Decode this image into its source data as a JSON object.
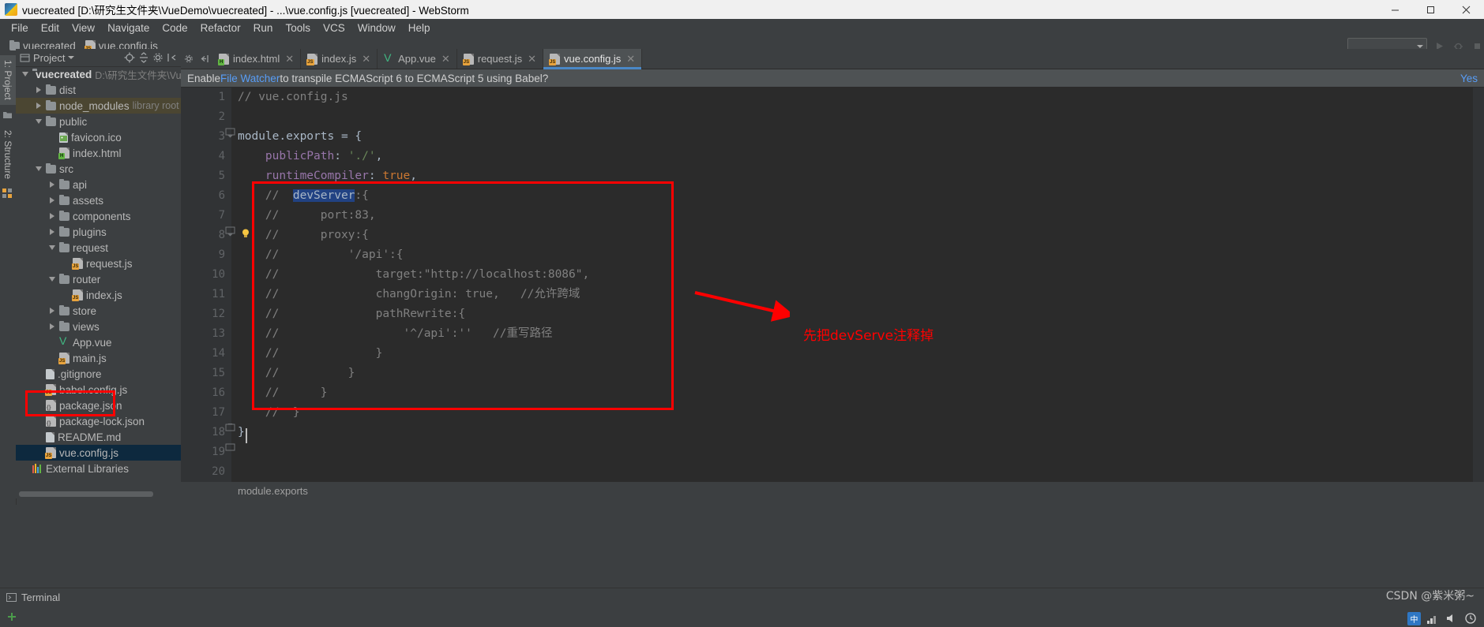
{
  "window": {
    "title": "vuecreated [D:\\研究生文件夹\\VueDemo\\vuecreated] - ...\\vue.config.js [vuecreated] - WebStorm",
    "icon": "webstorm-logo-icon",
    "minimize": "–",
    "maximize": "□",
    "close": "✕"
  },
  "menubar": {
    "items": [
      {
        "label": "File"
      },
      {
        "label": "Edit"
      },
      {
        "label": "View"
      },
      {
        "label": "Navigate"
      },
      {
        "label": "Code"
      },
      {
        "label": "Refactor"
      },
      {
        "label": "Run"
      },
      {
        "label": "Tools"
      },
      {
        "label": "VCS"
      },
      {
        "label": "Window"
      },
      {
        "label": "Help"
      }
    ]
  },
  "navbar": {
    "crumbs": [
      {
        "label": "vuecreated",
        "icon": "folder-icon"
      },
      {
        "label": "vue.config.js",
        "icon": "js-file-icon"
      }
    ],
    "run_config_placeholder": "",
    "run_button": "run-icon",
    "debug_button": "debug-icon",
    "stop_button": "stop-icon"
  },
  "toolstrip": {
    "left_tabs": [
      {
        "label": "1: Project",
        "active": true
      },
      {
        "label": "2: Structure",
        "active": false
      }
    ]
  },
  "project_panel": {
    "title": "Project",
    "header_icons": [
      "target-icon",
      "collapse-all-icon",
      "gear-icon",
      "hide-icon"
    ],
    "tree": [
      {
        "depth": 0,
        "arrow": "down",
        "icon": "folder-icon",
        "label": "vuecreated",
        "bold": true,
        "sub": "D:\\研究生文件夹\\VueDem",
        "state": "normal"
      },
      {
        "depth": 1,
        "arrow": "right",
        "icon": "folder-icon",
        "label": "dist",
        "sub": "",
        "state": "normal"
      },
      {
        "depth": 1,
        "arrow": "right",
        "icon": "folder-icon",
        "label": "node_modules",
        "sub": "library root",
        "state": "dim-hl"
      },
      {
        "depth": 1,
        "arrow": "down",
        "icon": "folder-icon",
        "label": "public",
        "sub": "",
        "state": "normal"
      },
      {
        "depth": 2,
        "arrow": "none",
        "icon": "image-file-icon",
        "label": "favicon.ico",
        "sub": "",
        "state": "normal"
      },
      {
        "depth": 2,
        "arrow": "none",
        "icon": "html-file-icon",
        "label": "index.html",
        "sub": "",
        "state": "normal"
      },
      {
        "depth": 1,
        "arrow": "down",
        "icon": "folder-icon",
        "label": "src",
        "sub": "",
        "state": "normal"
      },
      {
        "depth": 2,
        "arrow": "right",
        "icon": "folder-icon",
        "label": "api",
        "sub": "",
        "state": "normal"
      },
      {
        "depth": 2,
        "arrow": "right",
        "icon": "folder-icon",
        "label": "assets",
        "sub": "",
        "state": "normal"
      },
      {
        "depth": 2,
        "arrow": "right",
        "icon": "folder-icon",
        "label": "components",
        "sub": "",
        "state": "normal"
      },
      {
        "depth": 2,
        "arrow": "right",
        "icon": "folder-icon",
        "label": "plugins",
        "sub": "",
        "state": "normal"
      },
      {
        "depth": 2,
        "arrow": "down",
        "icon": "folder-icon",
        "label": "request",
        "sub": "",
        "state": "normal"
      },
      {
        "depth": 3,
        "arrow": "none",
        "icon": "js-file-icon",
        "label": "request.js",
        "sub": "",
        "state": "normal"
      },
      {
        "depth": 2,
        "arrow": "down",
        "icon": "folder-icon",
        "label": "router",
        "sub": "",
        "state": "normal"
      },
      {
        "depth": 3,
        "arrow": "none",
        "icon": "js-file-icon",
        "label": "index.js",
        "sub": "",
        "state": "normal"
      },
      {
        "depth": 2,
        "arrow": "right",
        "icon": "folder-icon",
        "label": "store",
        "sub": "",
        "state": "normal"
      },
      {
        "depth": 2,
        "arrow": "right",
        "icon": "folder-icon",
        "label": "views",
        "sub": "",
        "state": "normal"
      },
      {
        "depth": 2,
        "arrow": "none",
        "icon": "vue-file-icon",
        "label": "App.vue",
        "sub": "",
        "state": "normal"
      },
      {
        "depth": 2,
        "arrow": "none",
        "icon": "js-file-icon",
        "label": "main.js",
        "sub": "",
        "state": "normal"
      },
      {
        "depth": 1,
        "arrow": "none",
        "icon": "text-file-icon",
        "label": ".gitignore",
        "sub": "",
        "state": "normal"
      },
      {
        "depth": 1,
        "arrow": "none",
        "icon": "js-file-icon",
        "label": "babel.config.js",
        "sub": "",
        "state": "normal"
      },
      {
        "depth": 1,
        "arrow": "none",
        "icon": "json-file-icon",
        "label": "package.json",
        "sub": "",
        "state": "normal"
      },
      {
        "depth": 1,
        "arrow": "none",
        "icon": "json-file-icon",
        "label": "package-lock.json",
        "sub": "",
        "state": "normal"
      },
      {
        "depth": 1,
        "arrow": "none",
        "icon": "text-file-icon",
        "label": "README.md",
        "sub": "",
        "state": "normal"
      },
      {
        "depth": 1,
        "arrow": "none",
        "icon": "js-file-icon",
        "label": "vue.config.js",
        "sub": "",
        "state": "selected"
      },
      {
        "depth": 0,
        "arrow": "none",
        "icon": "libraries-icon",
        "label": "External Libraries",
        "sub": "",
        "state": "normal"
      }
    ]
  },
  "editor": {
    "tabs": [
      {
        "label": "index.html",
        "icon": "html-file-icon",
        "active": false
      },
      {
        "label": "index.js",
        "icon": "js-file-icon",
        "active": false
      },
      {
        "label": "App.vue",
        "icon": "vue-file-icon",
        "active": false
      },
      {
        "label": "request.js",
        "icon": "js-file-icon",
        "active": false
      },
      {
        "label": "vue.config.js",
        "icon": "js-file-icon",
        "active": true
      }
    ],
    "tab_close_glyph": "✕",
    "notification": {
      "prefix": "Enable ",
      "link": "File Watcher",
      "suffix": " to transpile ECMAScript 6 to ECMAScript 5 using Babel?",
      "action": "Yes"
    },
    "breadcrumb_bottom": "module.exports",
    "lines": [
      {
        "n": 1,
        "text": "// vue.config.js",
        "kind": "comment"
      },
      {
        "n": 2,
        "text": "",
        "kind": "plain"
      },
      {
        "n": 3,
        "text": "module.exports = {",
        "kind": "code-exports"
      },
      {
        "n": 4,
        "text": "    publicPath: './',",
        "kind": "code-publicpath"
      },
      {
        "n": 5,
        "text": "    runtimeCompiler: true,",
        "kind": "code-runtime"
      },
      {
        "n": 6,
        "text": "    //  devServer:{",
        "kind": "comment-sel"
      },
      {
        "n": 7,
        "text": "    //      port:83,",
        "kind": "comment"
      },
      {
        "n": 8,
        "text": "    //      proxy:{",
        "kind": "comment"
      },
      {
        "n": 9,
        "text": "    //          '/api':{",
        "kind": "comment"
      },
      {
        "n": 10,
        "text": "    //              target:\"http://localhost:8086\",",
        "kind": "comment"
      },
      {
        "n": 11,
        "text": "    //              changOrigin: true,   //允许跨域",
        "kind": "comment"
      },
      {
        "n": 12,
        "text": "    //              pathRewrite:{",
        "kind": "comment"
      },
      {
        "n": 13,
        "text": "    //                  '^/api':''   //重写路径",
        "kind": "comment"
      },
      {
        "n": 14,
        "text": "    //              }",
        "kind": "comment"
      },
      {
        "n": 15,
        "text": "    //          }",
        "kind": "comment"
      },
      {
        "n": 16,
        "text": "    //      }",
        "kind": "comment"
      },
      {
        "n": 17,
        "text": "    //  }",
        "kind": "comment"
      },
      {
        "n": 18,
        "text": "}",
        "kind": "plain"
      },
      {
        "n": 19,
        "text": "",
        "kind": "plain"
      },
      {
        "n": 20,
        "text": "",
        "kind": "plain"
      }
    ],
    "selected_token": "devServer"
  },
  "annotations": {
    "color": "#ff0000",
    "note": "先把devServe注释掉",
    "rect_code_label": "code-block-highlight",
    "rect_file_label": "vue-config-file-highlight",
    "arrow_label": "pointer-arrow"
  },
  "bottom": {
    "terminal_label": "Terminal",
    "terminal_icon": "terminal-icon"
  },
  "statusbar": {
    "watermark": "CSDN @紫米粥~",
    "tray_icons": [
      "ime-icon",
      "network-icon",
      "volume-icon",
      "clock-icon"
    ]
  }
}
